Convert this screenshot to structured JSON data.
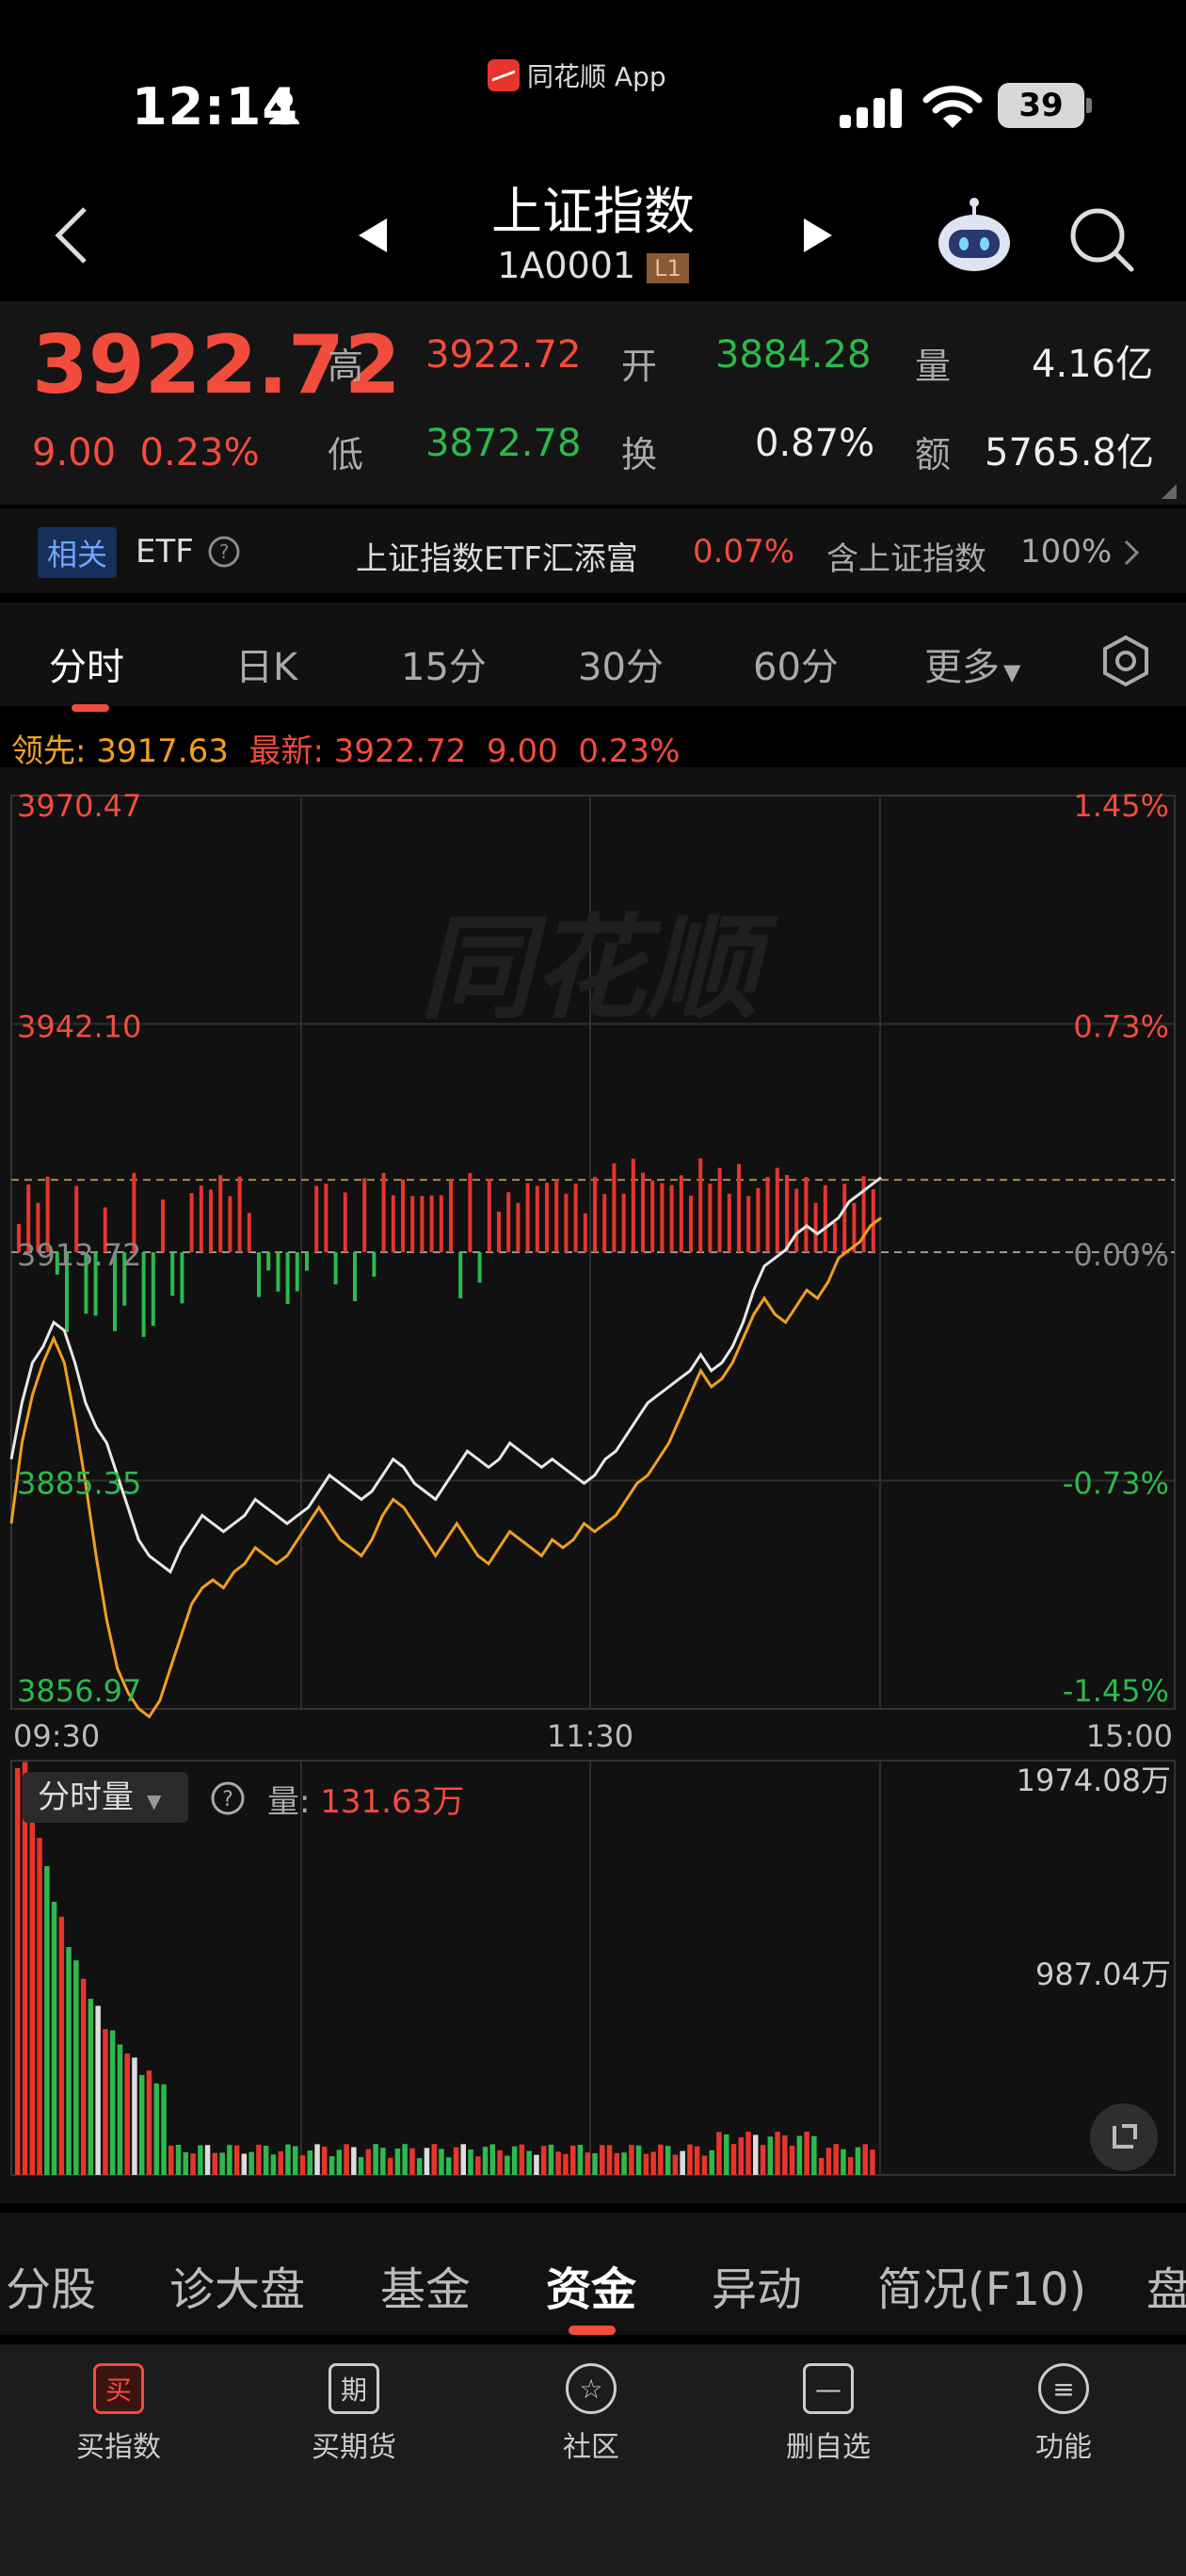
{
  "status_bar": {
    "time": "12:14",
    "app_name": "同花顺 App",
    "battery": "39"
  },
  "header": {
    "title": "上证指数",
    "code": "1A0001",
    "level_badge": "L1"
  },
  "quote": {
    "price": "3922.72",
    "change": "9.00",
    "change_pct": "0.23%",
    "high_label": "高",
    "high": "3922.72",
    "open_label": "开",
    "open": "3884.28",
    "volume_label": "量",
    "volume": "4.16亿",
    "low_label": "低",
    "low": "3872.78",
    "turnover_label": "换",
    "turnover": "0.87%",
    "amount_label": "额",
    "amount": "5765.8亿"
  },
  "etf_row": {
    "badge": "相关",
    "etf_label": "ETF",
    "etf_name": "上证指数ETF汇添富",
    "etf_change": "0.07%",
    "contains_label": "含上证指数",
    "contains_pct": "100%"
  },
  "tabs": [
    {
      "label": "分时",
      "active": true
    },
    {
      "label": "日K"
    },
    {
      "label": "15分"
    },
    {
      "label": "30分"
    },
    {
      "label": "60分"
    },
    {
      "label": "更多"
    }
  ],
  "info_line": {
    "lead_label": "领先:",
    "lead_value": "3917.63",
    "latest_label": "最新:",
    "latest_value": "3922.72",
    "latest_change": "9.00",
    "latest_pct": "0.23%"
  },
  "chart_data": {
    "type": "line",
    "y_left_ticks": [
      "3970.47",
      "3942.10",
      "3913.72",
      "3885.35",
      "3856.97"
    ],
    "y_right_ticks": [
      "1.45%",
      "0.73%",
      "0.00%",
      "-0.73%",
      "-1.45%"
    ],
    "x_ticks": [
      "09:30",
      "11:30",
      "15:00"
    ],
    "watermark": "同花顺",
    "series": [
      {
        "color": "#e8e8e8",
        "values": [
          3888,
          3895,
          3900,
          3902,
          3905,
          3904,
          3900,
          3895,
          3892,
          3890,
          3886,
          3882,
          3878,
          3876,
          3875,
          3874,
          3877,
          3879,
          3881,
          3880,
          3879,
          3880,
          3881,
          3883,
          3882,
          3881,
          3880,
          3881,
          3882,
          3884,
          3886,
          3885,
          3884,
          3883,
          3884,
          3886,
          3888,
          3887,
          3885,
          3884,
          3883,
          3885,
          3887,
          3889,
          3888,
          3887,
          3888,
          3890,
          3889,
          3888,
          3887,
          3888,
          3887,
          3886,
          3885,
          3886,
          3888,
          3889,
          3891,
          3893,
          3895,
          3896,
          3897,
          3898,
          3899,
          3901,
          3899,
          3900,
          3902,
          3905,
          3909,
          3912,
          3913,
          3914,
          3916,
          3917,
          3916,
          3917,
          3918,
          3920,
          3921,
          3922,
          3923
        ]
      },
      {
        "color": "#f0a020",
        "values": [
          3880,
          3890,
          3896,
          3900,
          3903,
          3900,
          3893,
          3885,
          3876,
          3868,
          3862,
          3859,
          3857,
          3856,
          3858,
          3862,
          3866,
          3870,
          3872,
          3873,
          3872,
          3874,
          3875,
          3877,
          3876,
          3875,
          3876,
          3878,
          3880,
          3882,
          3880,
          3878,
          3877,
          3876,
          3878,
          3881,
          3883,
          3882,
          3880,
          3878,
          3876,
          3878,
          3880,
          3878,
          3876,
          3875,
          3877,
          3879,
          3878,
          3877,
          3876,
          3878,
          3877,
          3878,
          3880,
          3879,
          3880,
          3881,
          3883,
          3885,
          3886,
          3888,
          3890,
          3893,
          3896,
          3899,
          3897,
          3898,
          3900,
          3903,
          3906,
          3908,
          3906,
          3905,
          3907,
          3909,
          3908,
          3910,
          3913,
          3914,
          3915,
          3917,
          3918
        ]
      }
    ],
    "volume_label": "分时量",
    "volume_text_label": "量:",
    "volume_value": "131.63万",
    "volume_ticks": [
      "1974.08万",
      "987.04万"
    ]
  },
  "sub_tabs": [
    {
      "label": "分股"
    },
    {
      "label": "诊大盘"
    },
    {
      "label": "基金"
    },
    {
      "label": "资金",
      "active": true
    },
    {
      "label": "异动"
    },
    {
      "label": "简况(F10)"
    },
    {
      "label": "盘"
    }
  ],
  "actions": [
    {
      "icon": "买",
      "label": "买指数"
    },
    {
      "icon": "期",
      "label": "买期货"
    },
    {
      "icon": "☆",
      "label": "社区"
    },
    {
      "icon": "—",
      "label": "删自选"
    },
    {
      "icon": "≡",
      "label": "功能"
    }
  ],
  "colors": {
    "red": "#f24c3d",
    "green": "#2db94d",
    "orange": "#f0a020"
  }
}
